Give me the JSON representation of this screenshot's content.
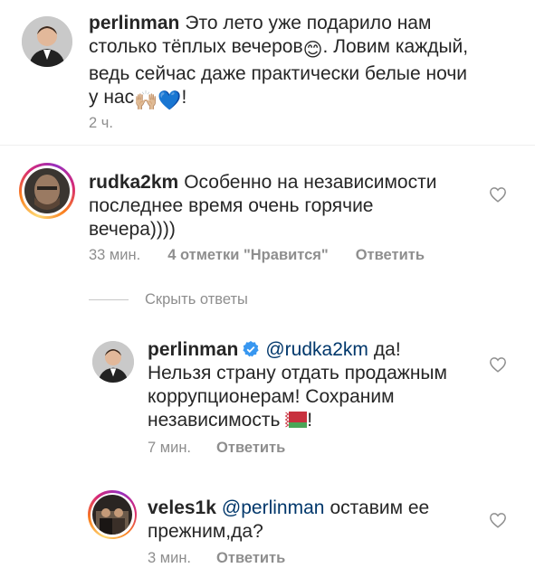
{
  "comments": [
    {
      "username": "perlinman",
      "text_lines": [
        "Это лето уже подарило нам",
        "столько тёплых вечеров",
        ". Ловим каждый,",
        "ведь сейчас даже практически белые ночи",
        "у нас",
        "!"
      ],
      "emoji_smile": "😊",
      "emoji_hands": "🙌🏼",
      "emoji_heart": "💙",
      "time": "2 ч."
    },
    {
      "username": "rudka2km",
      "text_lines": [
        "Особенно на независимости",
        "последнее время очень горячие",
        "вечера))))"
      ],
      "time": "33 мин.",
      "likes": "4 отметки \"Нравится\"",
      "reply_label": "Ответить"
    }
  ],
  "hide_replies_label": "Скрыть ответы",
  "replies": [
    {
      "username": "perlinman",
      "mention": "@rudka2km",
      "text_lines": [
        "да!",
        "Нельзя страну отдать продажным",
        "коррупционерам! Сохраним",
        "независимость",
        "!"
      ],
      "time": "7 мин.",
      "reply_label": "Ответить"
    },
    {
      "username": "veles1k",
      "mention": "@perlinman",
      "text_lines": [
        "оставим ее",
        "прежним,да?"
      ],
      "time": "3 мин.",
      "reply_label": "Ответить"
    }
  ],
  "icons": {
    "heart": "heart-outline-icon",
    "verified": "verified-badge-icon",
    "flag": "belarus-flag-icon"
  },
  "colors": {
    "mention": "#00376b",
    "meta": "#8e8e8e",
    "verified": "#3897f0"
  }
}
